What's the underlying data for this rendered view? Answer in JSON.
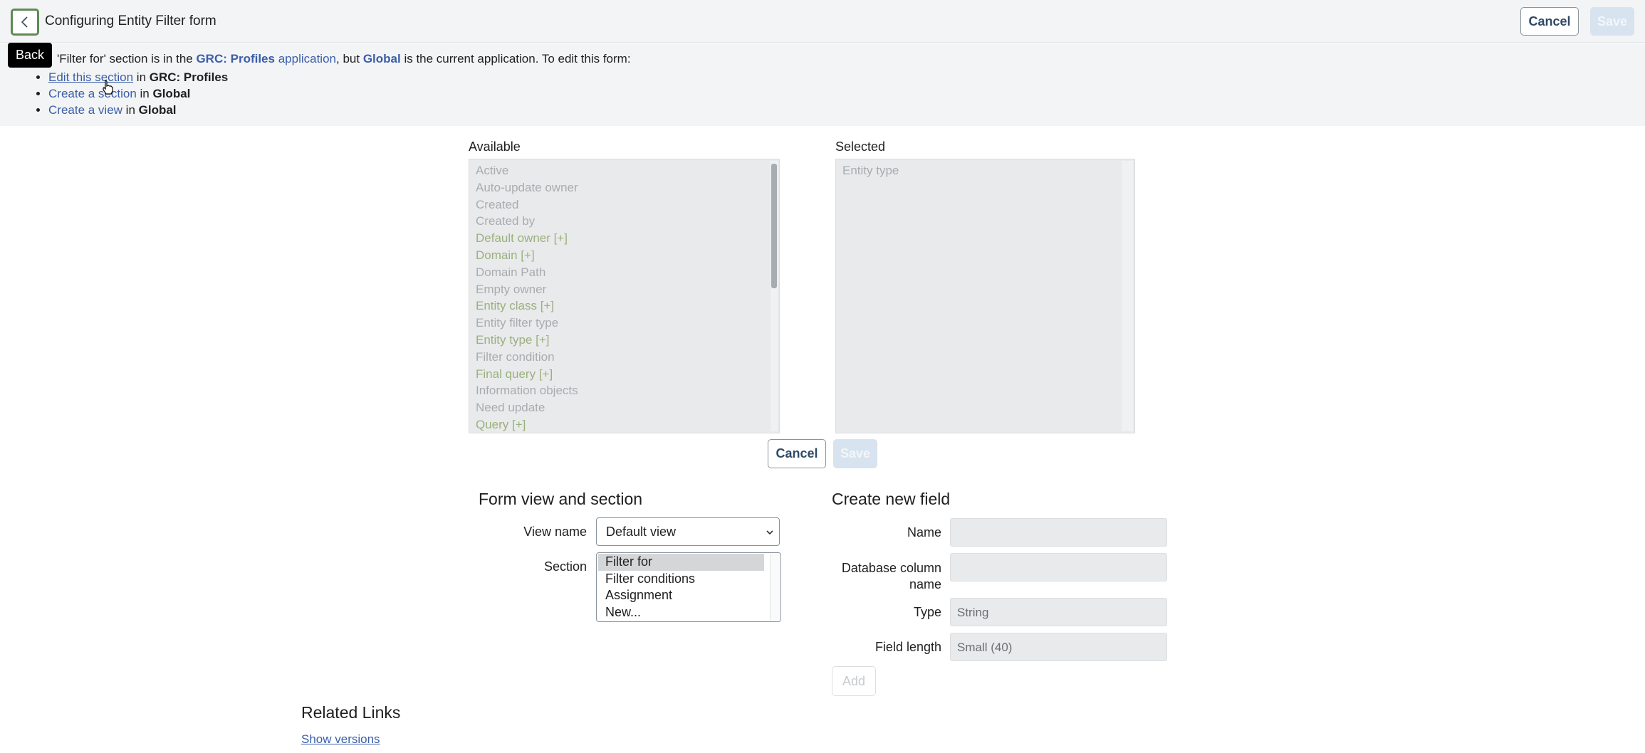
{
  "header": {
    "title": "Configuring Entity Filter form",
    "cancel_label": "Cancel",
    "save_label": "Save",
    "back_icon": "chevron-left-icon"
  },
  "tooltip": {
    "text": "Back"
  },
  "notice": {
    "message_prefix": "'Filter for' section is in the ",
    "app_name": "GRC: Profiles",
    "app_word": " application",
    "middle": ", but ",
    "current_app": "Global",
    "suffix": " is the current application. To edit this form:",
    "options": [
      {
        "link": "Edit this section",
        "in": " in ",
        "target": "GRC: Profiles"
      },
      {
        "link": "Create a section",
        "in": " in ",
        "target": "Global"
      },
      {
        "link": "Create a view",
        "in": " in ",
        "target": "Global"
      }
    ]
  },
  "slushbucket": {
    "available_label": "Available",
    "selected_label": "Selected",
    "available_items": [
      {
        "label": "Active",
        "ref": false
      },
      {
        "label": "Auto-update owner",
        "ref": false
      },
      {
        "label": "Created",
        "ref": false
      },
      {
        "label": "Created by",
        "ref": false
      },
      {
        "label": "Default owner [+]",
        "ref": true
      },
      {
        "label": "Domain [+]",
        "ref": true
      },
      {
        "label": "Domain Path",
        "ref": false
      },
      {
        "label": "Empty owner",
        "ref": false
      },
      {
        "label": "Entity class [+]",
        "ref": true
      },
      {
        "label": "Entity filter type",
        "ref": false
      },
      {
        "label": "Entity type [+]",
        "ref": true
      },
      {
        "label": "Filter condition",
        "ref": false
      },
      {
        "label": "Final query [+]",
        "ref": true
      },
      {
        "label": "Information objects",
        "ref": false
      },
      {
        "label": "Need update",
        "ref": false
      },
      {
        "label": "Query [+]",
        "ref": true
      }
    ],
    "selected_items": [
      {
        "label": "Entity type",
        "ref": false
      }
    ],
    "cancel_label": "Cancel",
    "save_label": "Save"
  },
  "form_view": {
    "title": "Form view and section",
    "view_name_label": "View name",
    "view_name_value": "Default view",
    "section_label": "Section",
    "sections": [
      "Filter for",
      "Filter conditions",
      "Assignment",
      "New..."
    ],
    "selected_section": "Filter for"
  },
  "new_field": {
    "title": "Create new field",
    "name_label": "Name",
    "name_value": "",
    "db_column_label_1": "Database column",
    "db_column_label_2": "name",
    "db_column_value": "",
    "type_label": "Type",
    "type_value": "String",
    "length_label": "Field length",
    "length_value": "Small (40)",
    "add_label": "Add"
  },
  "related": {
    "title": "Related Links",
    "show_versions": "Show versions"
  }
}
